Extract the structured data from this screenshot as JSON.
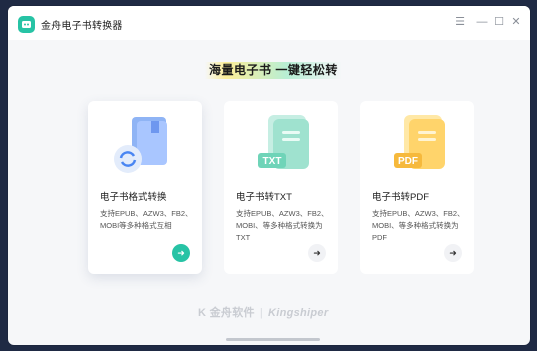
{
  "window": {
    "title": "金舟电子书转换器",
    "icons": {
      "menu": "menu-icon",
      "minimize": "minimize-icon",
      "maximize": "maximize-icon",
      "close": "close-icon"
    }
  },
  "slogan": "海量电子书  一键轻松转",
  "cards": [
    {
      "title": "电子书格式转换",
      "desc": "支持EPUB、AZW3、FB2、MOBI等多种格式互相",
      "icon": "book-convert-icon"
    },
    {
      "title": "电子书转TXT",
      "desc": "支持EPUB、AZW3、FB2、MOBI、等多种格式转换为TXT",
      "icon": "txt-file-icon",
      "badge": "TXT"
    },
    {
      "title": "电子书转PDF",
      "desc": "支持EPUB、AZW3、FB2、MOBI、等多种格式转换为PDF",
      "icon": "pdf-file-icon",
      "badge": "PDF"
    }
  ],
  "footer": {
    "brand_cn": "金舟软件",
    "brand_en": "Kingshiper"
  },
  "colors": {
    "accent": "#27c3a5",
    "background": "#f6f7f9"
  }
}
